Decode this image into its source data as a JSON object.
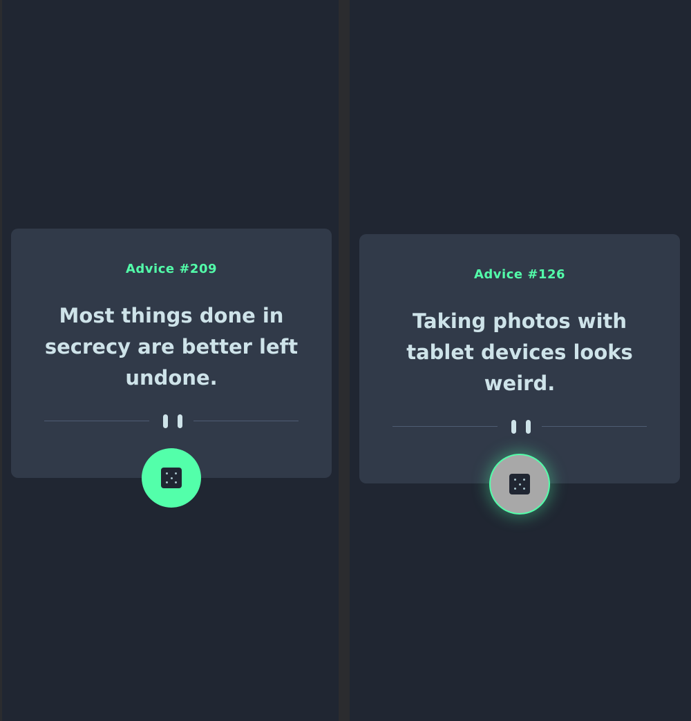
{
  "panels": [
    {
      "advice_id": "Advice #209",
      "advice_text": "Most things done in secrecy are better left undone.",
      "button_state": "default"
    },
    {
      "advice_id": "Advice #126",
      "advice_text": "Taking photos with tablet devices looks weird.",
      "button_state": "hover"
    }
  ],
  "icons": {
    "divider": "pause-icon",
    "button": "dice-icon"
  },
  "colors": {
    "accent": "#53ffaa",
    "background": "#202632",
    "card": "#313a49",
    "text": "#cee3e9",
    "divider": "#4f5d74",
    "button_hover": "#a8a8a8"
  }
}
